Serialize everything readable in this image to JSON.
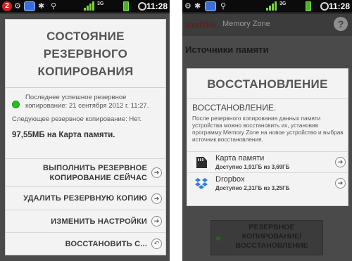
{
  "status_bar": {
    "notification_count": "2",
    "network_label": "3G",
    "time": "11:28",
    "icons": [
      "notification-badge",
      "usb-icon",
      "memory-zone-app-icon",
      "android-debug-icon",
      "signal-icon",
      "network-icon",
      "battery-icon",
      "alarm-icon"
    ]
  },
  "left_dialog": {
    "title": "СОСТОЯНИЕ РЕЗЕРВНОГО КОПИРОВАНИЯ",
    "last_backup": "Последнее успешное резервное копирование: 21 сентября 2012 г. 11:27.",
    "next_backup": "Следующее резервное копирование: Нет.",
    "card_size": "97,55МБ на Карта памяти.",
    "actions": [
      {
        "label": "ВЫПОЛНИТЬ РЕЗЕРВНОЕ КОПИРОВАНИЕ СЕЙЧАС",
        "icon": "arrow-right-icon"
      },
      {
        "label": "УДАЛИТЬ РЕЗЕРВНУЮ КОПИЮ",
        "icon": "arrow-right-icon"
      },
      {
        "label": "ИЗМЕНИТЬ НАСТРОЙКИ",
        "icon": "arrow-right-icon"
      },
      {
        "label": "ВОССТАНОВИТЬ С...",
        "icon": "return-icon"
      }
    ]
  },
  "right_screen": {
    "brand": "SanDisk",
    "brand_sub": "Memory Zone",
    "heading": "Источники памяти",
    "bottom_button": "РЕЗЕРВНОЕ КОПИРОВАНИЕ/ ВОССТАНОВЛЕНИЕ",
    "help_label": "?"
  },
  "right_dialog": {
    "title": "ВОССТАНОВЛЕНИЕ",
    "subtitle": "ВОССТАНОВЛЕНИЕ.",
    "description": "После резервного копирования данных памяти устройства можно восстановить их, установив программу Memory Zone на новое устройство и выбрав источник восстановления.",
    "sources": [
      {
        "name": "Карта памяти",
        "available": "Доступно 1,91ГБ из 3,69ГБ",
        "icon": "sd-card-icon"
      },
      {
        "name": "Dropbox",
        "available": "Доступно 2,31ГБ из 3,25ГБ",
        "icon": "dropbox-icon"
      }
    ]
  },
  "colors": {
    "status_green": "#27c21e",
    "dialog_bg": "#f3f3f3",
    "dim_overlay": "#4a4a4a"
  }
}
